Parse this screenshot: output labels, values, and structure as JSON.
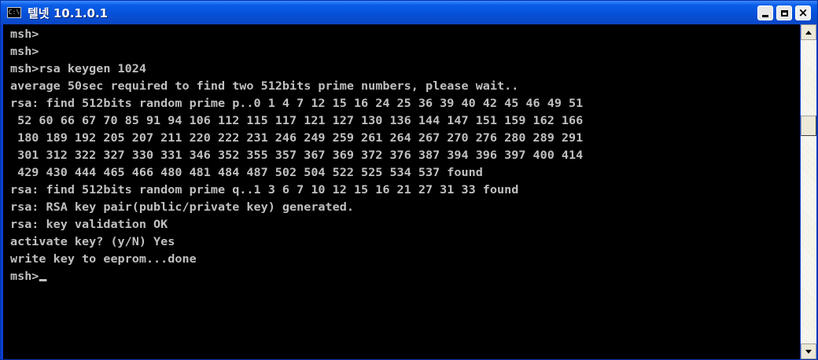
{
  "window": {
    "title": "텔넷 10.1.0.1",
    "app_icon_text": "C:\\",
    "buttons": [
      "minimize",
      "maximize",
      "close"
    ],
    "close_label": "×"
  },
  "console": {
    "lines": [
      "msh>",
      "msh>",
      "msh>rsa keygen 1024",
      "average 50sec required to find two 512bits prime numbers, please wait..",
      "rsa: find 512bits random prime p..0 1 4 7 12 15 16 24 25 36 39 40 42 45 46 49 51",
      " 52 60 66 67 70 85 91 94 106 112 115 117 121 127 130 136 144 147 151 159 162 166",
      " 180 189 192 205 207 211 220 222 231 246 249 259 261 264 267 270 276 280 289 291",
      " 301 312 322 327 330 331 346 352 355 357 367 369 372 376 387 394 396 397 400 414",
      " 429 430 444 465 466 480 481 484 487 502 504 522 525 534 537 found",
      "rsa: find 512bits random prime q..1 3 6 7 10 12 15 16 21 27 31 33 found",
      "rsa: RSA key pair(public/private key) generated.",
      "rsa: key validation OK",
      "activate key? (y/N) Yes",
      "write key to eeprom...done",
      "msh>"
    ]
  },
  "colors": {
    "titlebar": "#0650d8",
    "console_bg": "#000000",
    "console_text": "#c0c0c0"
  }
}
